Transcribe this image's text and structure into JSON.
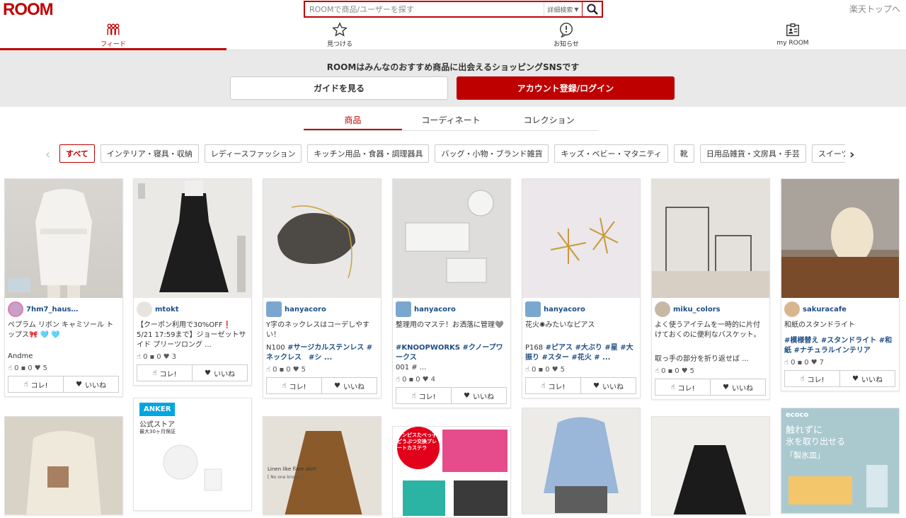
{
  "header": {
    "logo": "ROOM",
    "search_placeholder": "ROOMで商品/ユーザーを探す",
    "detail_search": "詳細検索",
    "rakuten_link": "楽天トップへ"
  },
  "nav": [
    {
      "label": "フィード",
      "icon": "people-icon"
    },
    {
      "label": "見つける",
      "icon": "star-icon"
    },
    {
      "label": "お知らせ",
      "icon": "alert-icon"
    },
    {
      "label": "my ROOM",
      "icon": "profile-card-icon"
    }
  ],
  "banner": {
    "text": "ROOMはみんなのおすすめ商品に出会えるショッピングSNSです",
    "guide_button": "ガイドを見る",
    "login_button": "アカウント登録/ログイン"
  },
  "tabs": [
    "商品",
    "コーディネート",
    "コレクション"
  ],
  "categories": [
    "すべて",
    "インテリア・寝具・収納",
    "レディースファッション",
    "キッチン用品・食器・調理器具",
    "バッグ・小物・ブランド雑貨",
    "キッズ・ベビー・マタニティ",
    "靴",
    "日用品雑貨・文房具・手芸",
    "スイーツ"
  ],
  "buttons": {
    "kore": "コレ!",
    "iine": "いいね"
  },
  "cards": [
    {
      "user": "7hm7_haus…",
      "desc": "ペプラム リボン キャミソール トップス🎀 🩵 🩵",
      "tags": "",
      "extra": "Andme",
      "stats": {
        "kore": "0",
        "comment": "0",
        "like": "5"
      }
    },
    {
      "user": "mtokt",
      "desc": "【クーポン利用で30%OFF❗ 5/21 17:59まで】ジョーゼットサイド プリーツロング ...",
      "tags": "",
      "extra": "",
      "stats": {
        "kore": "0",
        "comment": "0",
        "like": "3"
      }
    },
    {
      "user": "hanyacoro",
      "desc": "Y字のネックレスはコーデしやすい！",
      "tags_prefix": "N100",
      "tags": "#サージカルステンレス #ネックレス　#シ ...",
      "extra": "",
      "stats": {
        "kore": "0",
        "comment": "0",
        "like": "5"
      }
    },
    {
      "user": "hanyacoro",
      "desc": "整理用のマステ！お洒落に管理🩶",
      "tags": "#KNOOPWORKS #クノープワークス",
      "tags_suffix": "001 # ...",
      "extra": "",
      "stats": {
        "kore": "0",
        "comment": "0",
        "like": "4"
      }
    },
    {
      "user": "hanyacoro",
      "desc": "花火✺みたいなピアス",
      "tags_prefix": "P168",
      "tags": "#ピアス #大ぶり #星 #大振り #スター #花火 # ...",
      "extra": "",
      "stats": {
        "kore": "0",
        "comment": "0",
        "like": "5"
      }
    },
    {
      "user": "miku_colors",
      "desc": "よく使うアイテムを一時的に片付けておくのに便利なバスケット。",
      "tags": "",
      "extra": "取っ手の部分を折り返せば ...",
      "stats": {
        "kore": "0",
        "comment": "0",
        "like": "5"
      }
    },
    {
      "user": "sakuracafe",
      "desc": "和紙のスタンドライト",
      "tags": "#模様替え #スタンドライト #和紙 #ナチュラルインテリア",
      "extra": "",
      "stats": {
        "kore": "0",
        "comment": "0",
        "like": "7"
      }
    }
  ],
  "lower_cards": [
    {
      "overlay": ""
    },
    {
      "overlay": "ANKER",
      "sub1": "公式ストア",
      "sub2": "最大30ヶ月保証"
    },
    {
      "overlay": "Linen like flare skirt",
      "sub1": "[ No one knows ]"
    },
    {
      "overlay": "ギンピスたべっ子どうぶつ交換プレートカステラ"
    },
    {
      "overlay": ""
    },
    {
      "overlay": ""
    },
    {
      "overlay": "ecoco",
      "sub1": "触れずに",
      "sub2": "氷を取り出せる",
      "sub3": "「製氷皿」"
    }
  ],
  "colors": {
    "brand_red": "#bf0000",
    "link_blue": "#1d4d85"
  }
}
